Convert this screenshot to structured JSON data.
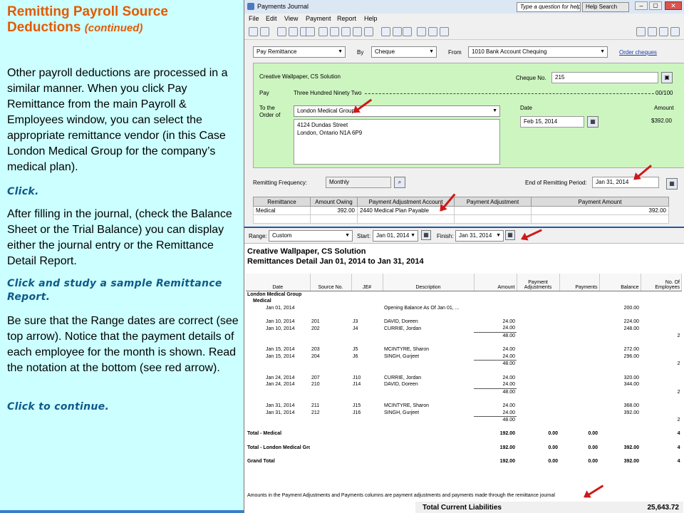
{
  "slide": {
    "title_main": "Remitting Payroll Source Deductions",
    "title_sub": "(continued)",
    "paragraph1": "Other payroll deductions are processed in a similar manner. When you click Pay Remittance from the main Payroll & Employees window, you can select the appropriate remittance vendor (in this Case London Medical Group for the company’s medical plan).",
    "click1": "Click.",
    "paragraph2": "After filling in the journal, (check the Balance Sheet or the Trial Balance) you can display either the journal entry or the Remittance Detail Report.",
    "click2": "Click and study a sample Remittance Report.",
    "paragraph3": "Be sure that the Range dates are correct (see top arrow). Notice that the payment details of each employee for the month is shown. Read the notation at the bottom (see red arrow).",
    "click3": "Click to continue."
  },
  "journal": {
    "window_title": "Payments Journal",
    "help_prompt": "Type a question for help",
    "help_search": "Help Search",
    "menu": [
      "File",
      "Edit",
      "View",
      "Payment",
      "Report",
      "Help"
    ],
    "transaction_type": "Pay Remittance",
    "by_label": "By",
    "by_method": "Cheque",
    "from_label": "From",
    "from_account": "1010 Bank Account Chequing",
    "order_cheques": "Order cheques",
    "company": "Creative Wallpaper, CS Solution",
    "cheque_no_label": "Cheque No.",
    "cheque_no": "215",
    "pay_label": "Pay",
    "pay_words": "Three Hundred Ninety Two",
    "pay_cents": "00/100",
    "to_order_label": "To the Order of",
    "vendor": "London Medical Group",
    "address_line1": "4124 Dundas Street",
    "address_line2": "London, Ontario N1A 6P9",
    "date_label": "Date",
    "date": "Feb 15, 2014",
    "amount_label": "Amount",
    "amount": "$392.00",
    "remit_freq_label": "Remitting Frequency:",
    "remit_freq": "Monthly",
    "end_period_label": "End of Remitting Period:",
    "end_period": "Jan 31, 2014",
    "grid_headers": [
      "Remittance",
      "Amount Owing",
      "Payment Adjustment Account",
      "Payment Adjustment",
      "Payment Amount"
    ],
    "grid_rows": [
      [
        "Medical",
        "392.00",
        "2440 Medical Plan Payable",
        "",
        "392.00"
      ]
    ]
  },
  "report": {
    "range_label": "Range:",
    "range": "Custom",
    "start_label": "Start:",
    "start": "Jan 01, 2014",
    "finish_label": "Finish:",
    "finish": "Jan 31, 2014",
    "company": "Creative Wallpaper, CS Solution",
    "title": "Remittances Detail Jan 01, 2014 to Jan 31, 2014",
    "headers": [
      "Date",
      "Source No.",
      "JE#",
      "Description",
      "Amount",
      "Payment Adjustments",
      "Payments",
      "Balance",
      "No. Of Employees"
    ],
    "rows": [
      {
        "cells": [
          "London Medical Group",
          "",
          "",
          "",
          "",
          "",
          "",
          "",
          ""
        ],
        "style": "bold"
      },
      {
        "cells": [
          "Medical",
          "",
          "",
          "",
          "",
          "",
          "",
          "",
          ""
        ],
        "style": "bold-indent"
      },
      {
        "cells": [
          "Jan 01, 2014",
          "",
          "",
          "Opening Balance As Of Jan 01, ...",
          "",
          "",
          "",
          "200.00",
          ""
        ],
        "style": "entry"
      },
      {
        "cells": [
          "",
          "",
          "",
          "",
          "",
          "",
          "",
          "",
          ""
        ],
        "style": "blank"
      },
      {
        "cells": [
          "Jan 10, 2014",
          "201",
          "J3",
          "DAVID, Doreen",
          "24.00",
          "",
          "",
          "224.00",
          ""
        ],
        "style": "entry"
      },
      {
        "cells": [
          "Jan 10, 2014",
          "202",
          "J4",
          "CURRIE, Jordan",
          "24.00",
          "",
          "",
          "248.00",
          ""
        ],
        "style": "entry"
      },
      {
        "cells": [
          "",
          "",
          "",
          "",
          "48.00",
          "",
          "",
          "",
          "2"
        ],
        "style": "subtotal"
      },
      {
        "cells": [
          "",
          "",
          "",
          "",
          "",
          "",
          "",
          "",
          ""
        ],
        "style": "blank"
      },
      {
        "cells": [
          "Jan 15, 2014",
          "203",
          "J5",
          "MCINTYRE, Sharon",
          "24.00",
          "",
          "",
          "272.00",
          ""
        ],
        "style": "entry"
      },
      {
        "cells": [
          "Jan 15, 2014",
          "204",
          "J6",
          "SINGH, Gurjeet",
          "24.00",
          "",
          "",
          "296.00",
          ""
        ],
        "style": "entry"
      },
      {
        "cells": [
          "",
          "",
          "",
          "",
          "48.00",
          "",
          "",
          "",
          "2"
        ],
        "style": "subtotal"
      },
      {
        "cells": [
          "",
          "",
          "",
          "",
          "",
          "",
          "",
          "",
          ""
        ],
        "style": "blank"
      },
      {
        "cells": [
          "Jan 24, 2014",
          "207",
          "J10",
          "CURRIE, Jordan",
          "24.00",
          "",
          "",
          "320.00",
          ""
        ],
        "style": "entry"
      },
      {
        "cells": [
          "Jan 24, 2014",
          "210",
          "J14",
          "DAVID, Doreen",
          "24.00",
          "",
          "",
          "344.00",
          ""
        ],
        "style": "entry"
      },
      {
        "cells": [
          "",
          "",
          "",
          "",
          "48.00",
          "",
          "",
          "",
          "2"
        ],
        "style": "subtotal"
      },
      {
        "cells": [
          "",
          "",
          "",
          "",
          "",
          "",
          "",
          "",
          ""
        ],
        "style": "blank"
      },
      {
        "cells": [
          "Jan 31, 2014",
          "211",
          "J15",
          "MCINTYRE, Sharon",
          "24.00",
          "",
          "",
          "368.00",
          ""
        ],
        "style": "entry"
      },
      {
        "cells": [
          "Jan 31, 2014",
          "212",
          "J16",
          "SINGH, Gurjeet",
          "24.00",
          "",
          "",
          "392.00",
          ""
        ],
        "style": "entry"
      },
      {
        "cells": [
          "",
          "",
          "",
          "",
          "48.00",
          "",
          "",
          "",
          "2"
        ],
        "style": "subtotal"
      },
      {
        "cells": [
          "",
          "",
          "",
          "",
          "",
          "",
          "",
          "",
          ""
        ],
        "style": "blank"
      },
      {
        "cells": [
          "Total - Medical",
          "",
          "",
          "",
          "192.00",
          "0.00",
          "0.00",
          "",
          "4"
        ],
        "style": "total"
      },
      {
        "cells": [
          "",
          "",
          "",
          "",
          "",
          "",
          "",
          "",
          ""
        ],
        "style": "blank"
      },
      {
        "cells": [
          "Total - London Medical Group",
          "",
          "",
          "",
          "192.00",
          "0.00",
          "0.00",
          "392.00",
          "4"
        ],
        "style": "total"
      },
      {
        "cells": [
          "",
          "",
          "",
          "",
          "",
          "",
          "",
          "",
          ""
        ],
        "style": "blank"
      },
      {
        "cells": [
          "Grand Total",
          "",
          "",
          "",
          "192.00",
          "0.00",
          "0.00",
          "392.00",
          "4"
        ],
        "style": "total"
      }
    ],
    "footnote": "Amounts in the Payment Adjustments and Payments columns are payment adjustments and payments made through the remittance journal",
    "total_current_liabilities_label": "Total Current Liabilities",
    "total_current_liabilities": "25,643.72"
  },
  "colors": {
    "title": "#e35a00",
    "click_text": "#0e5a8a",
    "slide_bg": "#ccffff",
    "form_bg": "#cdf5c0",
    "arrow": "#cc1a1a"
  }
}
